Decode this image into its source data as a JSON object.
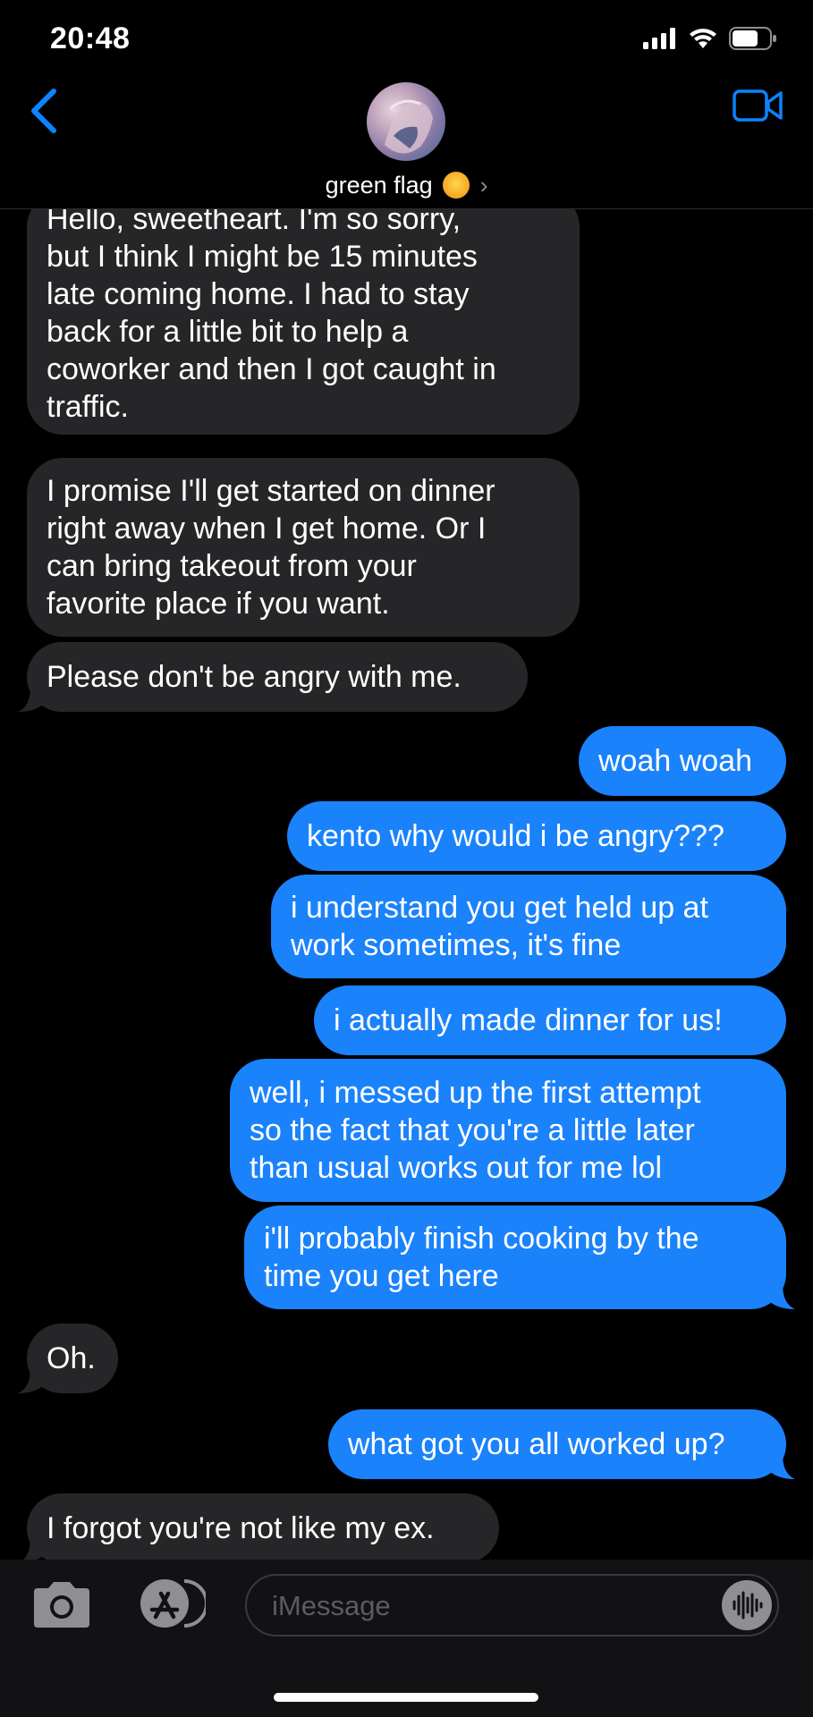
{
  "status": {
    "time": "20:48"
  },
  "header": {
    "contact_name": "green flag",
    "contact_emoji": "smiling-face-with-hearts-emoji"
  },
  "messages": [
    {
      "dir": "in",
      "lines": [
        "Hello, sweetheart. I'm so sorry,",
        "but I think I might be 15 minutes",
        "late coming home. I had to stay",
        "back for a little bit to help a",
        "coworker and then I got caught in",
        "traffic."
      ]
    },
    {
      "dir": "in",
      "lines": [
        "I promise I'll get started on dinner",
        "right away when I get home. Or I",
        "can bring takeout from your",
        "favorite place if you want."
      ]
    },
    {
      "dir": "in",
      "lines": [
        "Please don't be angry with me."
      ]
    },
    {
      "dir": "out",
      "lines": [
        "woah woah"
      ]
    },
    {
      "dir": "out",
      "lines": [
        "kento why would i be angry???"
      ]
    },
    {
      "dir": "out",
      "lines": [
        "i understand you get held up at",
        "work sometimes, it's fine"
      ]
    },
    {
      "dir": "out",
      "lines": [
        "i actually made dinner for us!"
      ]
    },
    {
      "dir": "out",
      "lines": [
        "well, i messed up the first attempt",
        "so the fact that you're a little later",
        "than usual works out for me lol"
      ]
    },
    {
      "dir": "out",
      "lines": [
        "i'll probably finish cooking by the",
        "time you get here"
      ]
    },
    {
      "dir": "in",
      "lines": [
        "Oh."
      ]
    },
    {
      "dir": "out",
      "lines": [
        "what got you all worked up?"
      ]
    },
    {
      "dir": "in",
      "lines": [
        "I forgot you're not like my ex."
      ]
    }
  ],
  "composer": {
    "placeholder": "iMessage"
  },
  "colors": {
    "incoming": "#262628",
    "outgoing": "#1a82fb",
    "accent": "#0a84ff"
  },
  "icons": [
    "back-chevron-icon",
    "video-camera-icon",
    "camera-icon",
    "app-store-icon",
    "audio-waveform-icon",
    "signal-icon",
    "wifi-icon",
    "battery-icon"
  ]
}
